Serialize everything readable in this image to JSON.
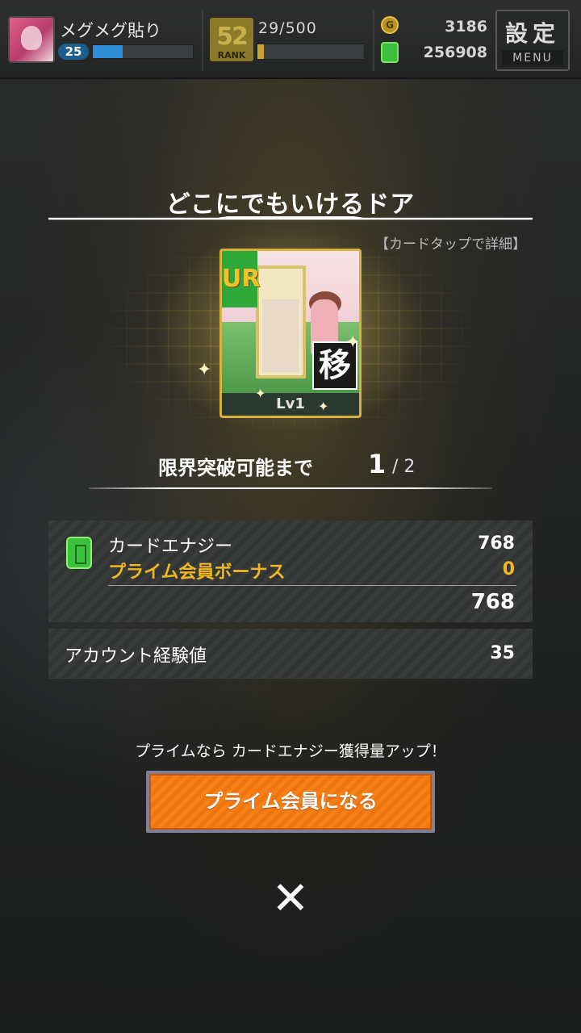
{
  "header": {
    "player_name": "メグメグ貼り",
    "level": "25",
    "exp_progress": 0.3,
    "rank_number": "52",
    "rank_label": "RANK",
    "stamina_text": "29/500",
    "stamina_progress": 0.06,
    "coins": "3186",
    "card_energy": "256908",
    "menu_kanji": "設定",
    "menu_label": "MENU"
  },
  "dialog": {
    "title": "どこにでもいけるドア",
    "detail_hint": "【カードタップで詳細】",
    "card": {
      "rarity": "UR",
      "type_kanji": "移",
      "level": "Lv1"
    },
    "limit_break": {
      "label": "限界突破可能まで",
      "current": "1",
      "total": "/ 2"
    },
    "rewards": {
      "energy_label": "カードエナジー",
      "energy_value": "768",
      "bonus_label": "プライム会員ボーナス",
      "bonus_value": "0",
      "total_value": "768",
      "exp_label": "アカウント経験値",
      "exp_value": "35"
    },
    "promo_text": "プライムなら カードエナジー獲得量アップ！",
    "prime_button_label": "プライム会員になる",
    "close_symbol": "✕"
  },
  "colors": {
    "accent_orange": "#f77f16",
    "bonus_gold": "#f0b81e",
    "rarity_green": "#2fa83a",
    "exp_blue": "#2f8fd6",
    "stamina_gold": "#c9a42e"
  },
  "icons": [
    "coin-icon",
    "energy-can-icon",
    "close-icon",
    "rank-icon",
    "sparkle-icon"
  ]
}
